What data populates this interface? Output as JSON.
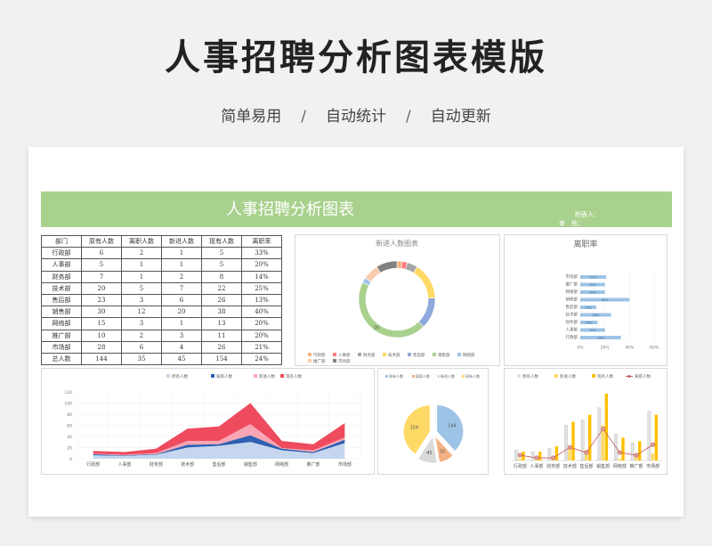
{
  "page": {
    "title": "人事招聘分析图表模版",
    "subtitle_items": [
      "简单易用",
      "自动统计",
      "自动更新"
    ],
    "separator": "/"
  },
  "sheet": {
    "banner_title": "人事招聘分析图表",
    "maker_label": "制表人：",
    "reviewer_label": "审　核："
  },
  "table": {
    "headers": [
      "部门",
      "原有人数",
      "离职人数",
      "新进人数",
      "现有人数",
      "离职率"
    ],
    "rows": [
      [
        "行政部",
        "6",
        "2",
        "1",
        "5",
        "33%"
      ],
      [
        "人事部",
        "5",
        "1",
        "1",
        "5",
        "20%"
      ],
      [
        "财务部",
        "7",
        "1",
        "2",
        "8",
        "14%"
      ],
      [
        "技术部",
        "20",
        "5",
        "7",
        "22",
        "25%"
      ],
      [
        "售后部",
        "23",
        "3",
        "6",
        "26",
        "13%"
      ],
      [
        "销售部",
        "30",
        "12",
        "20",
        "38",
        "40%"
      ],
      [
        "网络部",
        "15",
        "3",
        "1",
        "13",
        "20%"
      ],
      [
        "推广部",
        "10",
        "2",
        "3",
        "11",
        "20%"
      ],
      [
        "市场部",
        "28",
        "6",
        "4",
        "26",
        "21%"
      ],
      [
        "总人数",
        "144",
        "35",
        "45",
        "154",
        "24%"
      ]
    ]
  },
  "colors": {
    "green": "#a9d18e",
    "blue_bar": "#9dc3e6",
    "red": "#ff5050",
    "yellow": "#ffc000",
    "gray": "#bfbfbf",
    "dark_red": "#c55a5a"
  },
  "chart_data": [
    {
      "type": "pie",
      "variant": "donut",
      "title": "新进人数图表",
      "categories": [
        "行政部",
        "人事部",
        "财务部",
        "技术部",
        "售后部",
        "销售部",
        "网络部",
        "推广部",
        "市场部"
      ],
      "values": [
        1,
        1,
        2,
        7,
        6,
        20,
        1,
        3,
        4
      ],
      "data_labels": [
        "",
        "",
        "",
        "",
        "",
        "20",
        "",
        "",
        ""
      ],
      "colors": [
        "#f4b183",
        "#ff7c80",
        "#a5a5a5",
        "#ffd966",
        "#8faadc",
        "#a9d18e",
        "#9dc3e6",
        "#f8cbad",
        "#808080"
      ]
    },
    {
      "type": "bar",
      "orientation": "horizontal",
      "title": "离职率",
      "categories": [
        "行政部",
        "人事部",
        "财务部",
        "技术部",
        "售后部",
        "销售部",
        "网络部",
        "推广部",
        "市场部"
      ],
      "values": [
        33,
        20,
        14,
        25,
        13,
        40,
        20,
        20,
        21
      ],
      "value_labels": [
        "33%",
        "20%",
        "14%",
        "25%",
        "13%",
        "40%",
        "20%",
        "20%",
        "21%"
      ],
      "xlim": [
        0,
        60
      ],
      "xticks": [
        "0%",
        "20%",
        "40%",
        "60%"
      ]
    },
    {
      "type": "area",
      "legend": [
        "原有人数",
        "离职人数",
        "新进人数",
        "现有人数"
      ],
      "categories": [
        "行政部",
        "人事部",
        "财务部",
        "技术部",
        "售后部",
        "销售部",
        "网络部",
        "推广部",
        "市场部"
      ],
      "series": [
        {
          "name": "原有人数",
          "values": [
            6,
            5,
            7,
            20,
            23,
            30,
            15,
            10,
            28
          ],
          "color": "#c5d6ee"
        },
        {
          "name": "离职人数",
          "values": [
            2,
            1,
            1,
            5,
            3,
            12,
            3,
            2,
            6
          ],
          "color": "#2e5fb0"
        },
        {
          "name": "新进人数",
          "values": [
            1,
            1,
            2,
            7,
            6,
            20,
            1,
            3,
            4
          ],
          "color": "#f8a5b4"
        },
        {
          "name": "现有人数",
          "values": [
            5,
            5,
            8,
            22,
            26,
            38,
            13,
            11,
            26
          ],
          "color": "#ee4b5e"
        }
      ],
      "stacked": true,
      "ylim": [
        0,
        120
      ],
      "yticks": [
        0,
        20,
        40,
        60,
        80,
        100,
        120
      ]
    },
    {
      "type": "pie",
      "legend": [
        "原有人数",
        "离职人数",
        "新进人数",
        "现有人数"
      ],
      "categories": [
        "原有人数",
        "离职人数",
        "新进人数",
        "现有人数"
      ],
      "values": [
        144,
        35,
        45,
        154
      ],
      "data_labels": [
        "144",
        "35",
        "45",
        "154"
      ],
      "colors": [
        "#9dc3e6",
        "#f4b183",
        "#d9d9d9",
        "#ffd966"
      ]
    },
    {
      "type": "bar",
      "legend": [
        "原有人数",
        "新进人数",
        "现有人数",
        "离职人数"
      ],
      "categories": [
        "行政部",
        "人事部",
        "财务部",
        "技术部",
        "售后部",
        "销售部",
        "网络部",
        "推广部",
        "市场部"
      ],
      "series": [
        {
          "name": "原有人数",
          "values": [
            6,
            5,
            7,
            20,
            23,
            30,
            15,
            10,
            28
          ],
          "color": "#e2e2e2"
        },
        {
          "name": "新进人数",
          "values": [
            1,
            1,
            2,
            7,
            6,
            20,
            1,
            3,
            4
          ],
          "color": "#ffd966"
        },
        {
          "name": "现有人数",
          "values": [
            5,
            5,
            8,
            22,
            26,
            38,
            13,
            11,
            26
          ],
          "color": "#ffc000"
        },
        {
          "name": "离职人数",
          "type": "line",
          "values": [
            2,
            1,
            1,
            5,
            3,
            12,
            3,
            2,
            6
          ],
          "color": "#c55a5a"
        }
      ]
    }
  ]
}
